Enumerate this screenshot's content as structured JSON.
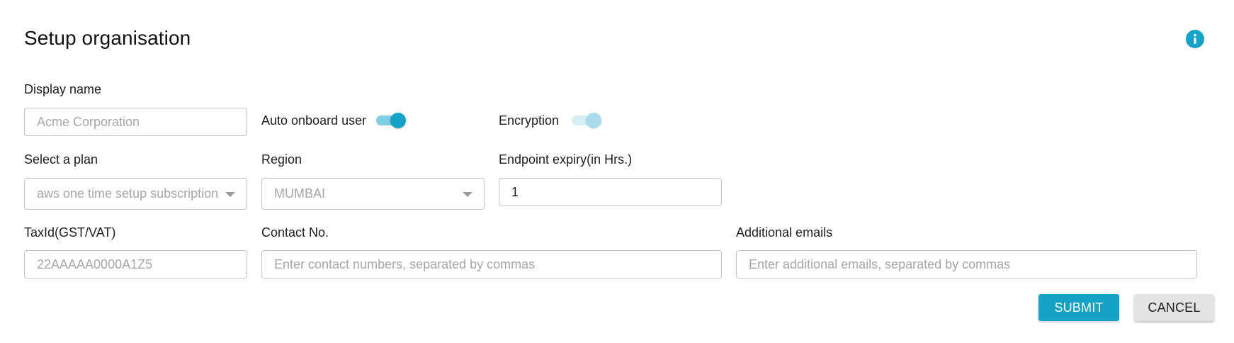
{
  "header": {
    "title": "Setup organisation",
    "info_icon": "info-icon"
  },
  "form": {
    "display_name": {
      "label": "Display name",
      "placeholder": "Acme Corporation"
    },
    "auto_onboard": {
      "label": "Auto onboard user",
      "state": "on"
    },
    "encryption": {
      "label": "Encryption",
      "state": "on-disabled"
    },
    "plan": {
      "label": "Select a plan",
      "value": "aws one time setup subscription"
    },
    "region": {
      "label": "Region",
      "value": "MUMBAI"
    },
    "endpoint_expiry": {
      "label": "Endpoint expiry(in Hrs.)",
      "value": "1"
    },
    "tax_id": {
      "label": "TaxId(GST/VAT)",
      "placeholder": "22AAAAA0000A1Z5"
    },
    "contact": {
      "label": "Contact No.",
      "placeholder": "Enter contact numbers, separated by commas"
    },
    "emails": {
      "label": "Additional emails",
      "placeholder": "Enter additional emails, separated by commas"
    }
  },
  "actions": {
    "submit_label": "SUBMIT",
    "cancel_label": "CANCEL"
  },
  "colors": {
    "accent": "#14a3c7",
    "border": "#c4c4c4",
    "placeholder": "#a7a7a7",
    "cancel_bg": "#e3e3e3"
  }
}
